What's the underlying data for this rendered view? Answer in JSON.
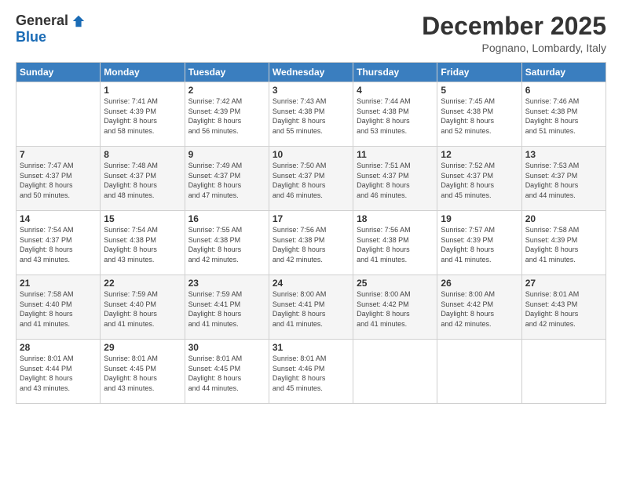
{
  "header": {
    "logo_general": "General",
    "logo_blue": "Blue",
    "month_title": "December 2025",
    "subtitle": "Pognano, Lombardy, Italy"
  },
  "days_of_week": [
    "Sunday",
    "Monday",
    "Tuesday",
    "Wednesday",
    "Thursday",
    "Friday",
    "Saturday"
  ],
  "weeks": [
    [
      {
        "day": "",
        "info": ""
      },
      {
        "day": "1",
        "info": "Sunrise: 7:41 AM\nSunset: 4:39 PM\nDaylight: 8 hours\nand 58 minutes."
      },
      {
        "day": "2",
        "info": "Sunrise: 7:42 AM\nSunset: 4:39 PM\nDaylight: 8 hours\nand 56 minutes."
      },
      {
        "day": "3",
        "info": "Sunrise: 7:43 AM\nSunset: 4:38 PM\nDaylight: 8 hours\nand 55 minutes."
      },
      {
        "day": "4",
        "info": "Sunrise: 7:44 AM\nSunset: 4:38 PM\nDaylight: 8 hours\nand 53 minutes."
      },
      {
        "day": "5",
        "info": "Sunrise: 7:45 AM\nSunset: 4:38 PM\nDaylight: 8 hours\nand 52 minutes."
      },
      {
        "day": "6",
        "info": "Sunrise: 7:46 AM\nSunset: 4:38 PM\nDaylight: 8 hours\nand 51 minutes."
      }
    ],
    [
      {
        "day": "7",
        "info": "Sunrise: 7:47 AM\nSunset: 4:37 PM\nDaylight: 8 hours\nand 50 minutes."
      },
      {
        "day": "8",
        "info": "Sunrise: 7:48 AM\nSunset: 4:37 PM\nDaylight: 8 hours\nand 48 minutes."
      },
      {
        "day": "9",
        "info": "Sunrise: 7:49 AM\nSunset: 4:37 PM\nDaylight: 8 hours\nand 47 minutes."
      },
      {
        "day": "10",
        "info": "Sunrise: 7:50 AM\nSunset: 4:37 PM\nDaylight: 8 hours\nand 46 minutes."
      },
      {
        "day": "11",
        "info": "Sunrise: 7:51 AM\nSunset: 4:37 PM\nDaylight: 8 hours\nand 46 minutes."
      },
      {
        "day": "12",
        "info": "Sunrise: 7:52 AM\nSunset: 4:37 PM\nDaylight: 8 hours\nand 45 minutes."
      },
      {
        "day": "13",
        "info": "Sunrise: 7:53 AM\nSunset: 4:37 PM\nDaylight: 8 hours\nand 44 minutes."
      }
    ],
    [
      {
        "day": "14",
        "info": "Sunrise: 7:54 AM\nSunset: 4:37 PM\nDaylight: 8 hours\nand 43 minutes."
      },
      {
        "day": "15",
        "info": "Sunrise: 7:54 AM\nSunset: 4:38 PM\nDaylight: 8 hours\nand 43 minutes."
      },
      {
        "day": "16",
        "info": "Sunrise: 7:55 AM\nSunset: 4:38 PM\nDaylight: 8 hours\nand 42 minutes."
      },
      {
        "day": "17",
        "info": "Sunrise: 7:56 AM\nSunset: 4:38 PM\nDaylight: 8 hours\nand 42 minutes."
      },
      {
        "day": "18",
        "info": "Sunrise: 7:56 AM\nSunset: 4:38 PM\nDaylight: 8 hours\nand 41 minutes."
      },
      {
        "day": "19",
        "info": "Sunrise: 7:57 AM\nSunset: 4:39 PM\nDaylight: 8 hours\nand 41 minutes."
      },
      {
        "day": "20",
        "info": "Sunrise: 7:58 AM\nSunset: 4:39 PM\nDaylight: 8 hours\nand 41 minutes."
      }
    ],
    [
      {
        "day": "21",
        "info": "Sunrise: 7:58 AM\nSunset: 4:40 PM\nDaylight: 8 hours\nand 41 minutes."
      },
      {
        "day": "22",
        "info": "Sunrise: 7:59 AM\nSunset: 4:40 PM\nDaylight: 8 hours\nand 41 minutes."
      },
      {
        "day": "23",
        "info": "Sunrise: 7:59 AM\nSunset: 4:41 PM\nDaylight: 8 hours\nand 41 minutes."
      },
      {
        "day": "24",
        "info": "Sunrise: 8:00 AM\nSunset: 4:41 PM\nDaylight: 8 hours\nand 41 minutes."
      },
      {
        "day": "25",
        "info": "Sunrise: 8:00 AM\nSunset: 4:42 PM\nDaylight: 8 hours\nand 41 minutes."
      },
      {
        "day": "26",
        "info": "Sunrise: 8:00 AM\nSunset: 4:42 PM\nDaylight: 8 hours\nand 42 minutes."
      },
      {
        "day": "27",
        "info": "Sunrise: 8:01 AM\nSunset: 4:43 PM\nDaylight: 8 hours\nand 42 minutes."
      }
    ],
    [
      {
        "day": "28",
        "info": "Sunrise: 8:01 AM\nSunset: 4:44 PM\nDaylight: 8 hours\nand 43 minutes."
      },
      {
        "day": "29",
        "info": "Sunrise: 8:01 AM\nSunset: 4:45 PM\nDaylight: 8 hours\nand 43 minutes."
      },
      {
        "day": "30",
        "info": "Sunrise: 8:01 AM\nSunset: 4:45 PM\nDaylight: 8 hours\nand 44 minutes."
      },
      {
        "day": "31",
        "info": "Sunrise: 8:01 AM\nSunset: 4:46 PM\nDaylight: 8 hours\nand 45 minutes."
      },
      {
        "day": "",
        "info": ""
      },
      {
        "day": "",
        "info": ""
      },
      {
        "day": "",
        "info": ""
      }
    ]
  ]
}
